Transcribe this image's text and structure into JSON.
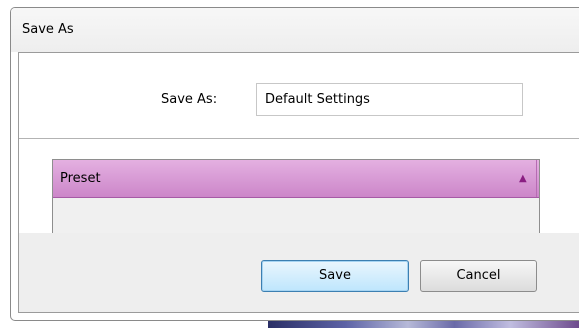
{
  "window": {
    "title": "Save As"
  },
  "form": {
    "save_as_label": "Save As:",
    "save_as_value": "Default Settings"
  },
  "preset_list": {
    "column_header": "Preset",
    "sort_icon": "▲",
    "items": []
  },
  "buttons": {
    "save_label": "Save",
    "cancel_label": "Cancel"
  },
  "colors": {
    "header_accent": "#cc86c9",
    "default_button_border": "#3c7fb1"
  }
}
